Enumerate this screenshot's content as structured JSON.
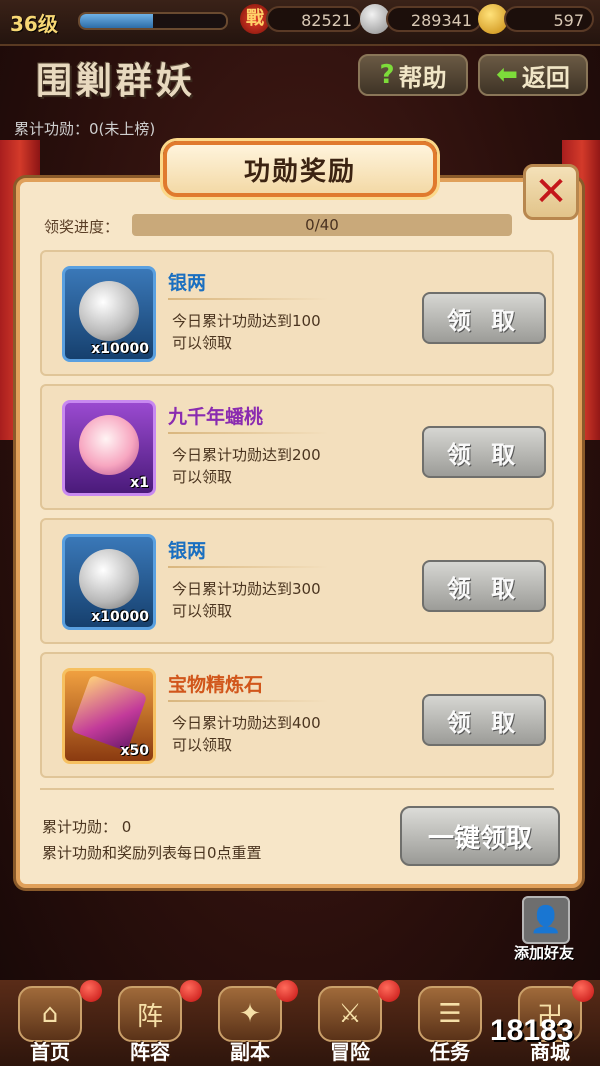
{
  "topbar": {
    "level": "36级",
    "xp_fraction": 0.5,
    "battle_power": "82521",
    "silver": "289341",
    "gold": "597"
  },
  "header": {
    "title": "围剿群妖",
    "help_label": "帮助",
    "back_label": "返回"
  },
  "background": {
    "merit_line": "累计功勋：0(未上榜)"
  },
  "dialog": {
    "title": "功勋奖励",
    "progress_label": "领奖进度：",
    "progress_text": "0/40",
    "progress_fraction": 0,
    "rewards": [
      {
        "name": "银两",
        "name_color": "#1a6fc0",
        "qty": "x10000",
        "line1": "今日累计功勋达到100",
        "line2": "可以领取",
        "claim": "领 取",
        "frame": "blue",
        "icon": "silver-coin-icon"
      },
      {
        "name": "九千年蟠桃",
        "name_color": "#8a2bb0",
        "qty": "x1",
        "line1": "今日累计功勋达到200",
        "line2": "可以领取",
        "claim": "领 取",
        "frame": "purple",
        "icon": "peach-icon"
      },
      {
        "name": "银两",
        "name_color": "#1a6fc0",
        "qty": "x10000",
        "line1": "今日累计功勋达到300",
        "line2": "可以领取",
        "claim": "领 取",
        "frame": "blue",
        "icon": "silver-coin-icon"
      },
      {
        "name": "宝物精炼石",
        "name_color": "#d1561b",
        "qty": "x50",
        "line1": "今日累计功勋达到400",
        "line2": "可以领取",
        "claim": "领 取",
        "frame": "orange",
        "icon": "refining-stone-icon"
      }
    ],
    "footer_merit": "累计功勋：  0",
    "footer_note": "累计功勋和奖励列表每日0点重置",
    "claim_all": "一键领取"
  },
  "side": {
    "add_friend": "添加好友"
  },
  "nav": [
    {
      "label": "首页",
      "icon": "home-icon",
      "glyph": "⌂"
    },
    {
      "label": "阵容",
      "icon": "lineup-icon",
      "glyph": "阵"
    },
    {
      "label": "副本",
      "icon": "dungeon-icon",
      "glyph": "✦"
    },
    {
      "label": "冒险",
      "icon": "adventure-icon",
      "glyph": "⚔"
    },
    {
      "label": "任务",
      "icon": "task-icon",
      "glyph": "☰"
    },
    {
      "label": "商城",
      "icon": "shop-icon",
      "glyph": "卍"
    }
  ],
  "watermark": "18183"
}
